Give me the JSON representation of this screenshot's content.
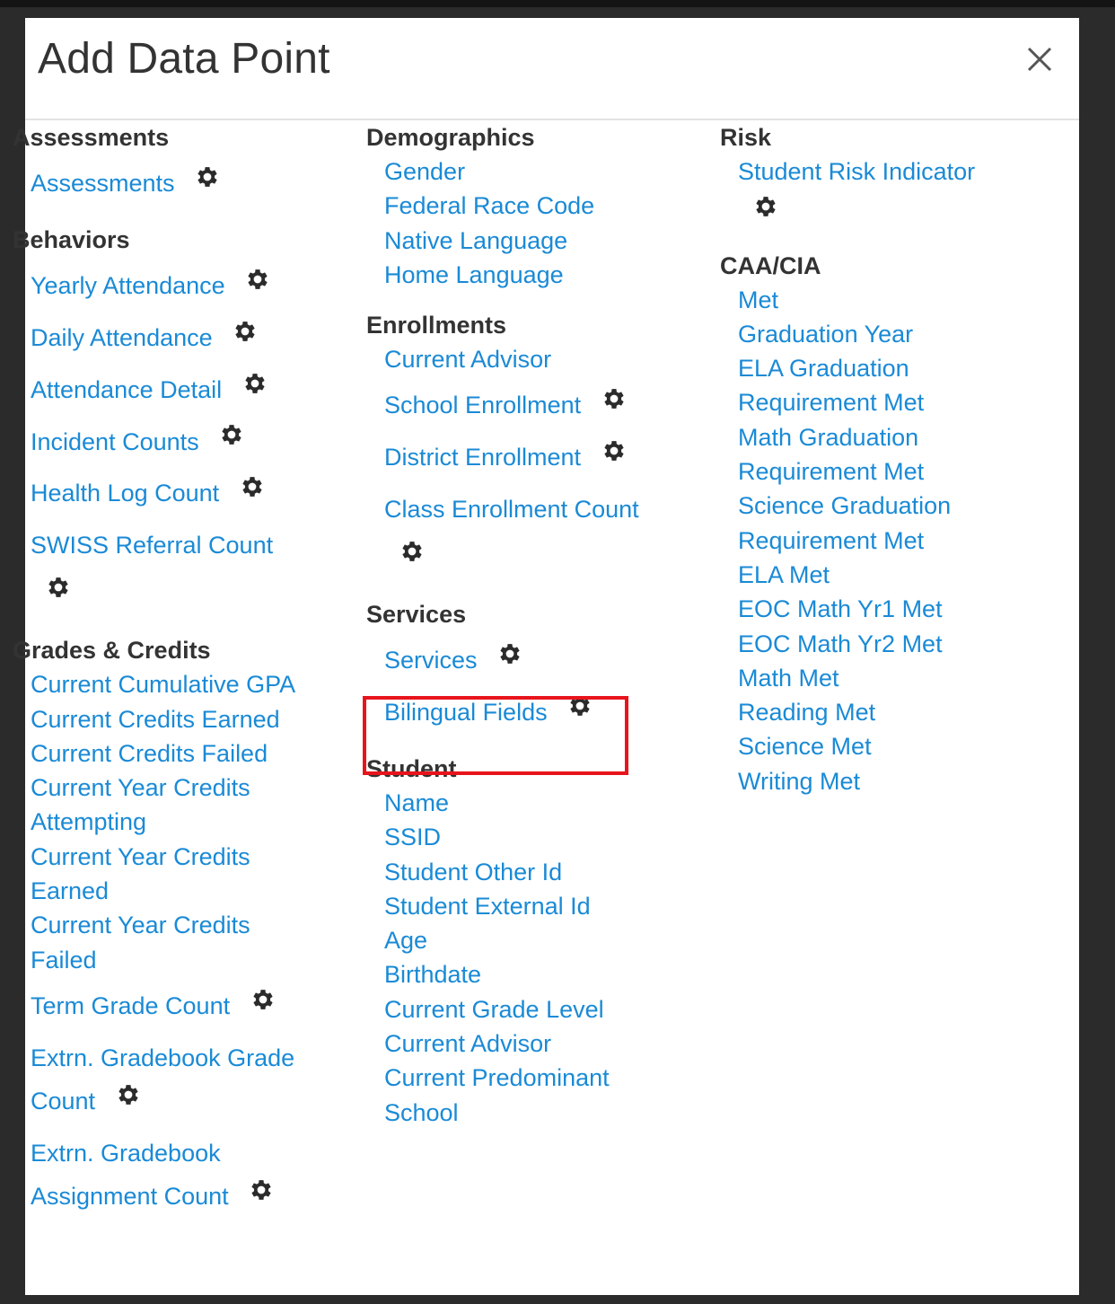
{
  "modal": {
    "title": "Add Data Point",
    "close_icon": "close-icon"
  },
  "columns": [
    {
      "sections": [
        {
          "title": "Assessments",
          "items": [
            {
              "label": "Assessments",
              "gear": true
            }
          ]
        },
        {
          "title": "Behaviors",
          "items": [
            {
              "label": "Yearly Attendance",
              "gear": true
            },
            {
              "label": "Daily Attendance",
              "gear": true
            },
            {
              "label": "Attendance Detail",
              "gear": true
            },
            {
              "label": "Incident Counts",
              "gear": true
            },
            {
              "label": "Health Log Count",
              "gear": true
            },
            {
              "label": "SWISS Referral Count",
              "gear": true
            }
          ]
        },
        {
          "title": "Grades & Credits",
          "items": [
            {
              "label": "Current Cumulative GPA"
            },
            {
              "label": "Current Credits Earned"
            },
            {
              "label": "Current Credits Failed"
            },
            {
              "label": "Current Year Credits Attempting"
            },
            {
              "label": "Current Year Credits Earned"
            },
            {
              "label": "Current Year Credits Failed"
            },
            {
              "label": "Term Grade Count",
              "gear": true
            },
            {
              "label": "Extrn. Gradebook Grade Count",
              "gear": true
            },
            {
              "label": "Extrn. Gradebook Assignment Count",
              "gear": true
            }
          ]
        }
      ]
    },
    {
      "sections": [
        {
          "title": "Demographics",
          "items": [
            {
              "label": "Gender"
            },
            {
              "label": "Federal Race Code"
            },
            {
              "label": "Native Language"
            },
            {
              "label": "Home Language"
            }
          ]
        },
        {
          "title": "Enrollments",
          "items": [
            {
              "label": "Current Advisor"
            },
            {
              "label": "School Enrollment",
              "gear": true
            },
            {
              "label": "District Enrollment",
              "gear": true
            },
            {
              "label": "Class Enrollment Count",
              "gear": true
            }
          ]
        },
        {
          "title": "Services",
          "items": [
            {
              "label": "Services",
              "gear": true
            },
            {
              "label": "Bilingual Fields",
              "gear": true,
              "highlighted": true
            }
          ]
        },
        {
          "title": "Student",
          "items": [
            {
              "label": "Name"
            },
            {
              "label": "SSID"
            },
            {
              "label": "Student Other Id"
            },
            {
              "label": "Student External Id"
            },
            {
              "label": "Age"
            },
            {
              "label": "Birthdate"
            },
            {
              "label": "Current Grade Level"
            },
            {
              "label": "Current Advisor"
            },
            {
              "label": "Current Predominant School"
            }
          ]
        }
      ]
    },
    {
      "sections": [
        {
          "title": "Risk",
          "items": [
            {
              "label": "Student Risk Indicator",
              "gear": true
            }
          ]
        },
        {
          "title": "CAA/CIA",
          "items": [
            {
              "label": "Met"
            },
            {
              "label": "Graduation Year"
            },
            {
              "label": "ELA Graduation Requirement Met"
            },
            {
              "label": "Math Graduation Requirement Met"
            },
            {
              "label": "Science Graduation Requirement Met"
            },
            {
              "label": "ELA Met"
            },
            {
              "label": "EOC Math Yr1 Met"
            },
            {
              "label": "EOC Math Yr2 Met"
            },
            {
              "label": "Math Met"
            },
            {
              "label": "Reading Met"
            },
            {
              "label": "Science Met"
            },
            {
              "label": "Writing Met"
            }
          ]
        }
      ]
    }
  ],
  "colors": {
    "link": "#1a8ad6",
    "heading": "#333333",
    "highlight": "#e8141c",
    "gear": "#2b2b2b"
  }
}
